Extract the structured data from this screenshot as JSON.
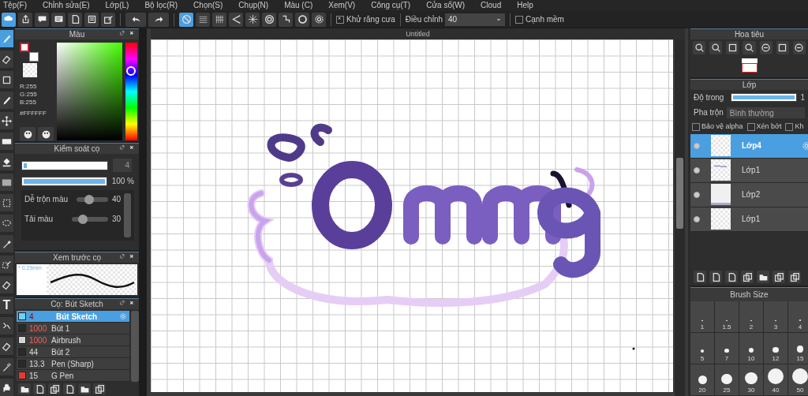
{
  "menu": [
    "Tệp(F)",
    "Chỉnh sửa(E)",
    "Lớp(L)",
    "Bộ lọc(R)",
    "Chọn(S)",
    "Chụp(N)",
    "Màu (C)",
    "Xem(V)",
    "Công cụ(T)",
    "Cửa sổ(W)",
    "Cloud",
    "Help"
  ],
  "toolbar": {
    "file_tools": [
      {
        "kind": "cloud",
        "selected": true
      },
      {
        "kind": "share",
        "selected": false
      },
      {
        "kind": "comment",
        "selected": false
      },
      {
        "kind": "note",
        "selected": false
      },
      {
        "kind": "page",
        "selected": false
      },
      {
        "kind": "list",
        "selected": false
      },
      {
        "kind": "edit",
        "selected": false
      }
    ],
    "history": [
      {
        "kind": "undo"
      },
      {
        "kind": "redo"
      }
    ],
    "snaps": [
      {
        "kind": "none",
        "selected": true
      },
      {
        "kind": "parallel",
        "selected": false
      },
      {
        "kind": "crosshatch",
        "selected": false
      },
      {
        "kind": "perspective",
        "selected": false
      },
      {
        "kind": "radial",
        "selected": false
      },
      {
        "kind": "concentric",
        "selected": false
      },
      {
        "kind": "curve",
        "selected": false
      },
      {
        "kind": "circle",
        "selected": false
      },
      {
        "kind": "gear",
        "selected": false
      }
    ],
    "anti_alias": {
      "label": "Khử răng cưa",
      "checked": true
    },
    "adjust": {
      "label": "Điều chỉnh",
      "value": "40"
    },
    "soft_edge": {
      "label": "Cạnh mềm",
      "checked": false
    }
  },
  "tools": [
    {
      "kind": "brush",
      "selected": true
    },
    {
      "kind": "eraser",
      "selected": false
    },
    {
      "kind": "square",
      "selected": false
    },
    {
      "kind": "brush",
      "selected": false
    },
    {
      "kind": "move",
      "selected": false
    },
    {
      "kind": "fill",
      "selected": false
    },
    {
      "kind": "bucket",
      "selected": false
    },
    {
      "kind": "gradient",
      "selected": false
    },
    {
      "kind": "select",
      "selected": false
    },
    {
      "kind": "lasso",
      "selected": false
    },
    {
      "kind": "wand",
      "selected": false
    },
    {
      "kind": "selpen",
      "selected": false
    },
    {
      "kind": "eraser",
      "selected": false
    },
    {
      "kind": "text",
      "label": "T",
      "selected": false
    },
    {
      "kind": "divide",
      "selected": false
    },
    {
      "kind": "eraser",
      "selected": false
    },
    {
      "kind": "dropper",
      "selected": false
    },
    {
      "kind": "hand",
      "selected": false
    }
  ],
  "color_panel": {
    "title": "Màu",
    "r": "R:255",
    "g": "G:255",
    "b": "B:255",
    "hex": "#FFFFFF",
    "hue": {
      "level": 0.71
    }
  },
  "brush_control": {
    "title": "Kiểm soát cọ",
    "size": {
      "level": 0.04,
      "value": "4"
    },
    "opacity": {
      "level": 1,
      "value": "100 %"
    },
    "sliders": [
      {
        "label": "Dễ trộn màu",
        "level": 0.4,
        "value": "40"
      },
      {
        "label": "Tải màu",
        "level": 0.3,
        "value": "30"
      }
    ]
  },
  "brush_preview": {
    "title": "Xem trước cọ",
    "size": "* 0.29mm"
  },
  "brushes": {
    "title": "Cọ: Bút Sketch",
    "items": [
      {
        "size": "4",
        "name": "Bút Sketch",
        "color": "#6fd0f5",
        "flagged": true,
        "selected": true
      },
      {
        "size": "1000",
        "name": "Bút 1",
        "color": "#2a2a2a",
        "flagged": true,
        "selected": false
      },
      {
        "size": "1000",
        "name": "Airbrush",
        "color": "#d4d4d4",
        "flagged": true,
        "selected": false
      },
      {
        "size": "44",
        "name": "Bút 2",
        "color": "#2a2a2a",
        "flagged": false,
        "selected": false
      },
      {
        "size": "13.3",
        "name": "Pen (Sharp)",
        "color": "#2a2a2a",
        "flagged": false,
        "selected": false
      },
      {
        "size": "15",
        "name": "G Pen",
        "color": "#e53935",
        "flagged": false,
        "selected": false
      }
    ]
  },
  "canvas": {
    "title": "Untitled"
  },
  "navigator": {
    "title": "Hoa tiêu"
  },
  "layers": {
    "title": "Lớp",
    "opacity_label": "Độ trong",
    "opacity": {
      "level": 1
    },
    "opacity_value": "1",
    "blend_label": "Pha trộn",
    "blend": "Bình thường",
    "options": [
      {
        "label": "Bảo vệ alpha",
        "checked": false
      },
      {
        "label": "Xén bớt",
        "checked": false
      },
      {
        "label": "Kh",
        "checked": false
      }
    ],
    "items": [
      {
        "name": "Lớp4",
        "kind": "empty",
        "selected": true,
        "visible": true
      },
      {
        "name": "Lớp1",
        "kind": "sketch",
        "selected": false,
        "visible": true
      },
      {
        "name": "Lớp2",
        "kind": "grid",
        "selected": false,
        "visible": true
      },
      {
        "name": "Lớp1",
        "kind": "empty",
        "selected": false,
        "visible": true
      }
    ]
  },
  "brush_size": {
    "title": "Brush Size",
    "sizes": [
      "1",
      "1.5",
      "2",
      "3",
      "4",
      "5",
      "7",
      "10",
      "12",
      "15",
      "20",
      "25",
      "30",
      "40",
      "50"
    ]
  }
}
